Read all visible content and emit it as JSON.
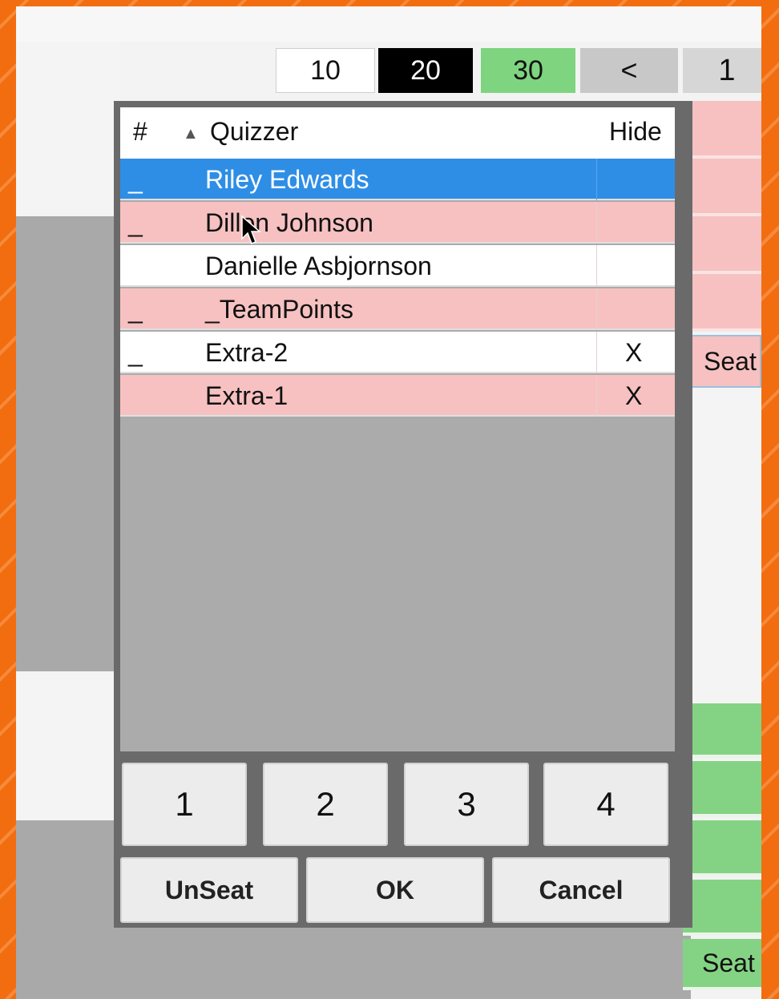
{
  "top_buttons": {
    "ten": "10",
    "twenty": "20",
    "thirty": "30",
    "prev": "<",
    "page": "1"
  },
  "dialog": {
    "headers": {
      "number": "#",
      "quizzer": "Quizzer",
      "hide": "Hide"
    },
    "rows": [
      {
        "num": "_",
        "name": "Riley Edwards",
        "hide": "",
        "style": "selected"
      },
      {
        "num": "_",
        "name": "Dillon Johnson",
        "hide": "",
        "style": "pink"
      },
      {
        "num": "",
        "name": "Danielle Asbjornson",
        "hide": "",
        "style": "white"
      },
      {
        "num": "_",
        "name": "_TeamPoints",
        "hide": "",
        "style": "pink"
      },
      {
        "num": "_",
        "name": "Extra-2",
        "hide": "X",
        "style": "white"
      },
      {
        "num": "",
        "name": "Extra-1",
        "hide": "X",
        "style": "pink"
      }
    ],
    "seat_buttons": [
      "1",
      "2",
      "3",
      "4"
    ],
    "actions": {
      "unseat": "UnSeat",
      "ok": "OK",
      "cancel": "Cancel"
    }
  },
  "right_column": {
    "seat_label_1": "Seat",
    "seat_label_2": "Seat"
  },
  "colors": {
    "frame": "#f36f12",
    "pink_row": "#f7c1c1",
    "selected_row": "#2e8ee6",
    "green": "#7fd47f",
    "gray_bg": "#ababab"
  }
}
